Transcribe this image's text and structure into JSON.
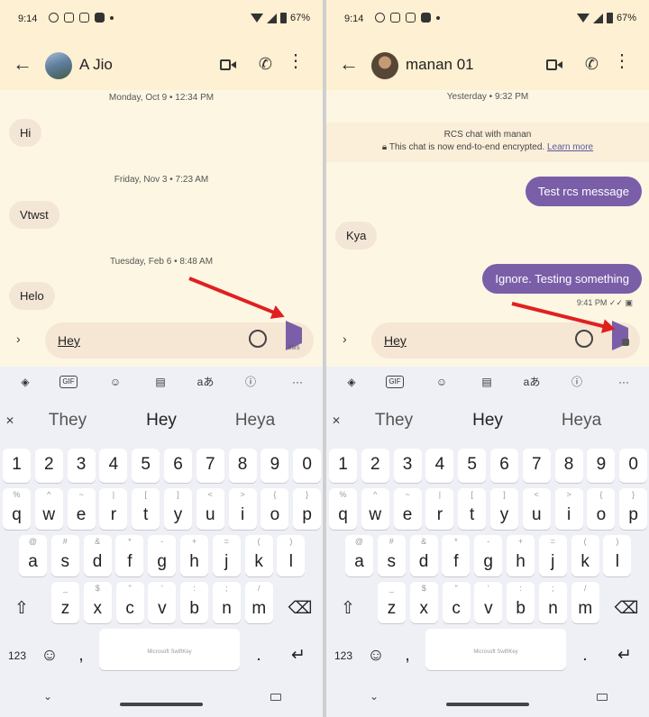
{
  "status_bar": {
    "time": "9:14",
    "battery": "67%"
  },
  "screens": [
    {
      "contact_name": "A Jio",
      "timestamps": [
        "Monday, Oct 9 • 12:34 PM",
        "Friday, Nov 3 • 7:23 AM",
        "Tuesday, Feb 6 • 8:48 AM"
      ],
      "received": [
        "Hi",
        "Vtwst",
        "Helo"
      ],
      "composer_text": "Hey",
      "send_label": "SMS"
    },
    {
      "contact_name": "manan 01",
      "timestamps": [
        "Yesterday • 9:32 PM"
      ],
      "rcs_title": "RCS chat with manan",
      "encryption_text": "This chat is now end-to-end encrypted.",
      "learn_more": "Learn more",
      "sent": [
        "Test rcs message",
        "Ignore. Testing something"
      ],
      "received": [
        "Kya"
      ],
      "message_time": "9:41 PM",
      "composer_text": "Hey"
    }
  ],
  "keyboard": {
    "suggestions": [
      "They",
      "Hey",
      "Heya"
    ],
    "gif_label": "GIF",
    "translate_label": "aあ",
    "more_label": "···",
    "number_row": [
      "1",
      "2",
      "3",
      "4",
      "5",
      "6",
      "7",
      "8",
      "9",
      "0"
    ],
    "row1": [
      "q",
      "w",
      "e",
      "r",
      "t",
      "y",
      "u",
      "i",
      "o",
      "p"
    ],
    "row1_hints": [
      "%",
      "^",
      "~",
      "|",
      "[",
      "]",
      "<",
      ">",
      "{",
      "}"
    ],
    "row2": [
      "a",
      "s",
      "d",
      "f",
      "g",
      "h",
      "j",
      "k",
      "l"
    ],
    "row2_hints": [
      "@",
      "#",
      "&",
      "*",
      "-",
      "+",
      "=",
      "(",
      ")"
    ],
    "row3": [
      "z",
      "x",
      "c",
      "v",
      "b",
      "n",
      "m"
    ],
    "row3_hints": [
      "_",
      "$",
      "\"",
      "'",
      ":",
      ";",
      "/"
    ],
    "numbers_key": "123",
    "comma": ",",
    "period": ".",
    "space_label": "Microsoft SwiftKey"
  },
  "colors": {
    "accent": "#7a5ea8",
    "background": "#fdf6e3",
    "annotation_arrow": "#e02020"
  }
}
